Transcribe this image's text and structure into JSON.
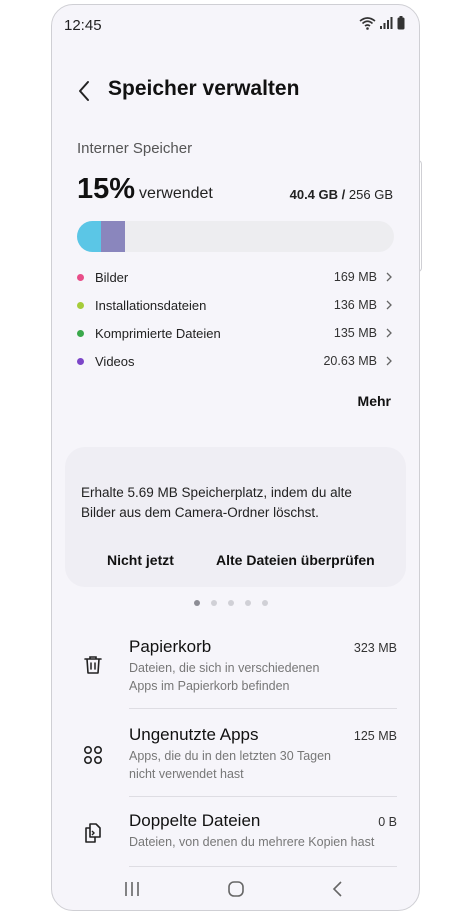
{
  "status": {
    "time": "12:45"
  },
  "header": {
    "title": "Speicher verwalten"
  },
  "storage": {
    "label": "Interner Speicher",
    "percent": "15%",
    "percent_text": "verwendet",
    "used": "40.4 GB",
    "separator": "/",
    "total": "256 GB",
    "bar_colors": [
      "#5bc6e6",
      "#8a86bd"
    ],
    "categories": [
      {
        "name": "Bilder",
        "size": "169 MB",
        "color": "#e84d88"
      },
      {
        "name": "Installationsdateien",
        "size": "136 MB",
        "color": "#a6cc3a"
      },
      {
        "name": "Komprimierte Dateien",
        "size": "135 MB",
        "color": "#3aa84b"
      },
      {
        "name": "Videos",
        "size": "20.63 MB",
        "color": "#7c46c8"
      }
    ],
    "more_label": "Mehr"
  },
  "suggestion": {
    "message": "Erhalte 5.69 MB Speicherplatz, indem du alte Bilder aus dem Camera-Ordner löschst.",
    "dismiss_label": "Nicht jetzt",
    "review_label": "Alte Dateien überprüfen",
    "page_count": 5,
    "active_page": 1
  },
  "items": [
    {
      "title": "Papierkorb",
      "size": "323 MB",
      "description": "Dateien, die sich in verschiedenen Apps im Papierkorb befinden",
      "icon": "trash-icon"
    },
    {
      "title": "Ungenutzte Apps",
      "size": "125 MB",
      "description": "Apps, die du in den letzten 30 Tagen nicht verwendet hast",
      "icon": "apps-grid-icon"
    },
    {
      "title": "Doppelte Dateien",
      "size": "0 B",
      "description": "Dateien, von denen du mehrere Kopien hast",
      "icon": "duplicate-files-icon"
    }
  ]
}
